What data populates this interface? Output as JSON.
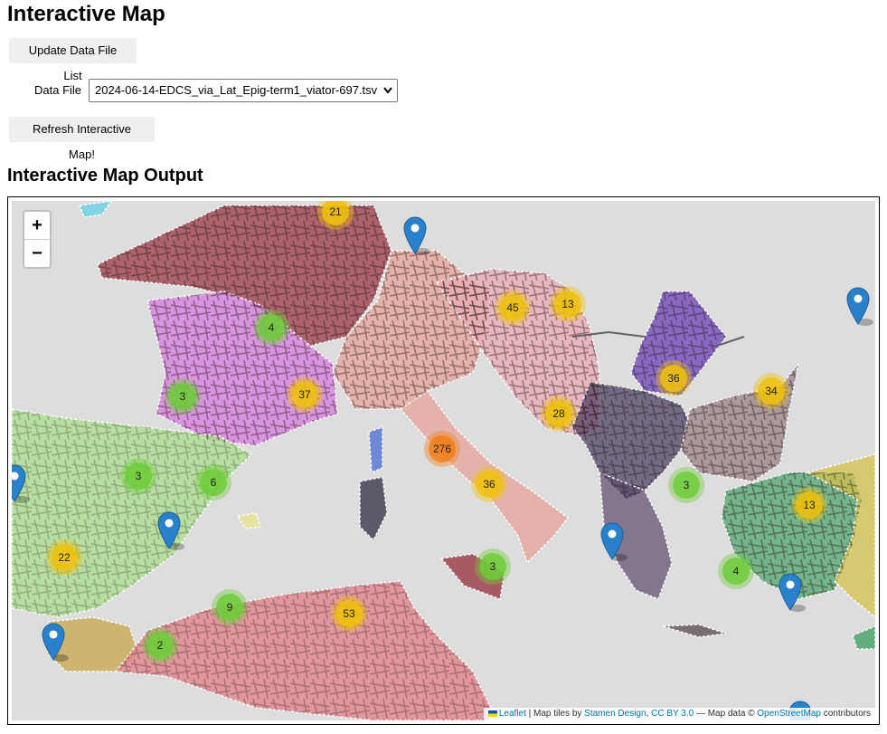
{
  "header": {
    "title": "Interactive Map"
  },
  "controls": {
    "update_label": "Update Data File List",
    "file_label": "Data File",
    "file_value": "2024-06-14-EDCS_via_Lat_Epig-term1_viator-697.tsv",
    "refresh_label": "Refresh Interactive Map!"
  },
  "map_section": {
    "title": "Interactive Map Output"
  },
  "map": {
    "zoom_in": "+",
    "zoom_out": "−",
    "clusters": [
      {
        "count": "21",
        "level": "medium"
      },
      {
        "count": "4",
        "level": "small"
      },
      {
        "count": "45",
        "level": "medium"
      },
      {
        "count": "13",
        "level": "medium"
      },
      {
        "count": "3",
        "level": "small"
      },
      {
        "count": "37",
        "level": "medium"
      },
      {
        "count": "36",
        "level": "medium"
      },
      {
        "count": "34",
        "level": "medium"
      },
      {
        "count": "28",
        "level": "medium"
      },
      {
        "count": "276",
        "level": "large"
      },
      {
        "count": "3",
        "level": "small"
      },
      {
        "count": "6",
        "level": "small"
      },
      {
        "count": "36",
        "level": "medium"
      },
      {
        "count": "3",
        "level": "small"
      },
      {
        "count": "13",
        "level": "medium"
      },
      {
        "count": "22",
        "level": "medium"
      },
      {
        "count": "3",
        "level": "small"
      },
      {
        "count": "4",
        "level": "small"
      },
      {
        "count": "9",
        "level": "small"
      },
      {
        "count": "53",
        "level": "medium"
      },
      {
        "count": "2",
        "level": "small"
      }
    ],
    "marker_icon": "map-pin-icon",
    "attribution": {
      "leaflet": "Leaflet",
      "sep1": " | Map tiles by ",
      "stamen": "Stamen Design",
      "sep2": ", ",
      "license": "CC BY 3.0",
      "sep3": " — Map data © ",
      "osm": "OpenStreetMap",
      "sep4": " contributors"
    },
    "colors": {
      "sea": "#dddddd",
      "cluster_small": "#6ecc39",
      "cluster_medium": "#f0c20c",
      "cluster_large": "#f18017",
      "marker": "#2a81cb"
    }
  }
}
